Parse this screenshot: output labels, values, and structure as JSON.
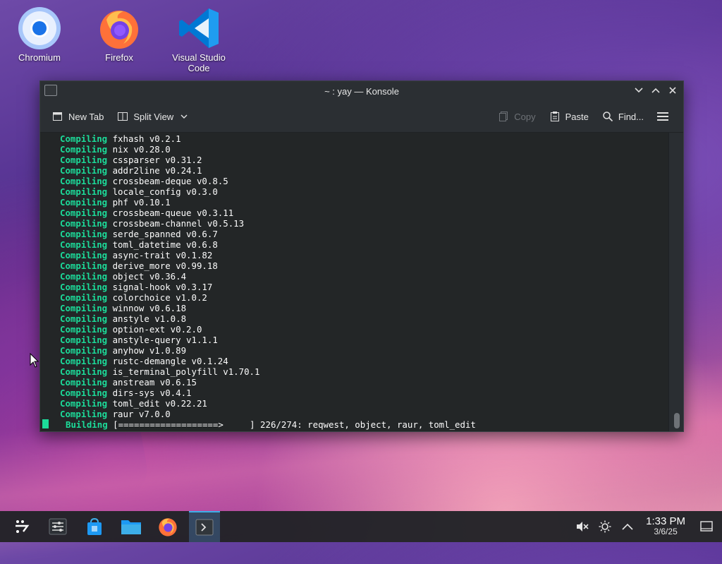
{
  "desktop": {
    "icons": [
      {
        "label": "Chromium",
        "icon": "chromium-icon"
      },
      {
        "label": "Firefox",
        "icon": "firefox-icon"
      },
      {
        "label": "Visual Studio Code",
        "icon": "vscode-icon"
      }
    ]
  },
  "window": {
    "title": "~ : yay — Konsole",
    "toolbar": {
      "new_tab": "New Tab",
      "split_view": "Split View",
      "copy": "Copy",
      "paste": "Paste",
      "find": "Find..."
    },
    "terminal_lines": [
      {
        "kw": "Compiling",
        "text": "fxhash v0.2.1"
      },
      {
        "kw": "Compiling",
        "text": "nix v0.28.0"
      },
      {
        "kw": "Compiling",
        "text": "cssparser v0.31.2"
      },
      {
        "kw": "Compiling",
        "text": "addr2line v0.24.1"
      },
      {
        "kw": "Compiling",
        "text": "crossbeam-deque v0.8.5"
      },
      {
        "kw": "Compiling",
        "text": "locale_config v0.3.0"
      },
      {
        "kw": "Compiling",
        "text": "phf v0.10.1"
      },
      {
        "kw": "Compiling",
        "text": "crossbeam-queue v0.3.11"
      },
      {
        "kw": "Compiling",
        "text": "crossbeam-channel v0.5.13"
      },
      {
        "kw": "Compiling",
        "text": "serde_spanned v0.6.7"
      },
      {
        "kw": "Compiling",
        "text": "toml_datetime v0.6.8"
      },
      {
        "kw": "Compiling",
        "text": "async-trait v0.1.82"
      },
      {
        "kw": "Compiling",
        "text": "derive_more v0.99.18"
      },
      {
        "kw": "Compiling",
        "text": "object v0.36.4"
      },
      {
        "kw": "Compiling",
        "text": "signal-hook v0.3.17"
      },
      {
        "kw": "Compiling",
        "text": "colorchoice v1.0.2"
      },
      {
        "kw": "Compiling",
        "text": "winnow v0.6.18"
      },
      {
        "kw": "Compiling",
        "text": "anstyle v1.0.8"
      },
      {
        "kw": "Compiling",
        "text": "option-ext v0.2.0"
      },
      {
        "kw": "Compiling",
        "text": "anstyle-query v1.1.1"
      },
      {
        "kw": "Compiling",
        "text": "anyhow v1.0.89"
      },
      {
        "kw": "Compiling",
        "text": "rustc-demangle v0.1.24"
      },
      {
        "kw": "Compiling",
        "text": "is_terminal_polyfill v1.70.1"
      },
      {
        "kw": "Compiling",
        "text": "anstream v0.6.15"
      },
      {
        "kw": "Compiling",
        "text": "dirs-sys v0.4.1"
      },
      {
        "kw": "Compiling",
        "text": "toml_edit v0.22.21"
      },
      {
        "kw": "Compiling",
        "text": "raur v7.0.0"
      }
    ],
    "building": {
      "kw": "Building",
      "text": "[===================>     ] 226/274: reqwest, object, raur, toml_edit"
    }
  },
  "taskbar": {
    "items": [
      "app-launcher-icon",
      "system-settings-icon",
      "discover-store-icon",
      "file-manager-icon",
      "firefox-icon",
      "konsole-icon"
    ],
    "time": "1:33 PM",
    "date": "3/6/25"
  }
}
